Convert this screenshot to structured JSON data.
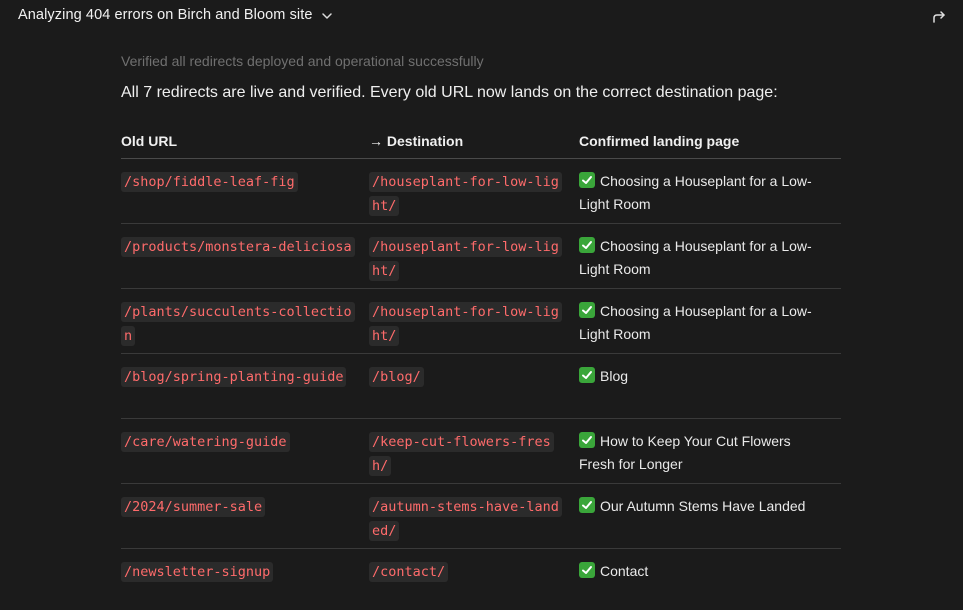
{
  "header": {
    "title": "Analyzing 404 errors on Birch and Bloom site"
  },
  "status_line": "Verified all redirects deployed and operational successfully",
  "summary": "All 7 redirects are live and verified. Every old URL now lands on the correct destination page:",
  "table": {
    "headers": {
      "old_url": "Old URL",
      "destination": "→ Destination",
      "landing": "Confirmed landing page"
    },
    "rows": [
      {
        "old_url": "/shop/fiddle-leaf-fig",
        "destination": "/houseplant-for-low-light/",
        "landing": "Choosing a Houseplant for a Low-Light Room"
      },
      {
        "old_url": "/products/monstera-deliciosa",
        "destination": "/houseplant-for-low-light/",
        "landing": "Choosing a Houseplant for a Low-Light Room"
      },
      {
        "old_url": "/plants/succulents-collection",
        "destination": "/houseplant-for-low-light/",
        "landing": "Choosing a Houseplant for a Low-Light Room"
      },
      {
        "old_url": "/blog/spring-planting-guide",
        "destination": "/blog/",
        "landing": "Blog"
      },
      {
        "old_url": "/care/watering-guide",
        "destination": "/keep-cut-flowers-fresh/",
        "landing": "How to Keep Your Cut Flowers Fresh for Longer"
      },
      {
        "old_url": "/2024/summer-sale",
        "destination": "/autumn-stems-have-landed/",
        "landing": "Our Autumn Stems Have Landed"
      },
      {
        "old_url": "/newsletter-signup",
        "destination": "/contact/",
        "landing": "Contact"
      }
    ]
  },
  "icons": {
    "check": "check-mark-button-icon",
    "chevron": "chevron-down-icon",
    "share": "share-arrow-icon"
  },
  "colors": {
    "background": "#1b1b1b",
    "code_text": "#ff6b6b",
    "code_bg": "#2b2b2b",
    "check_bg": "#3aa63a"
  }
}
